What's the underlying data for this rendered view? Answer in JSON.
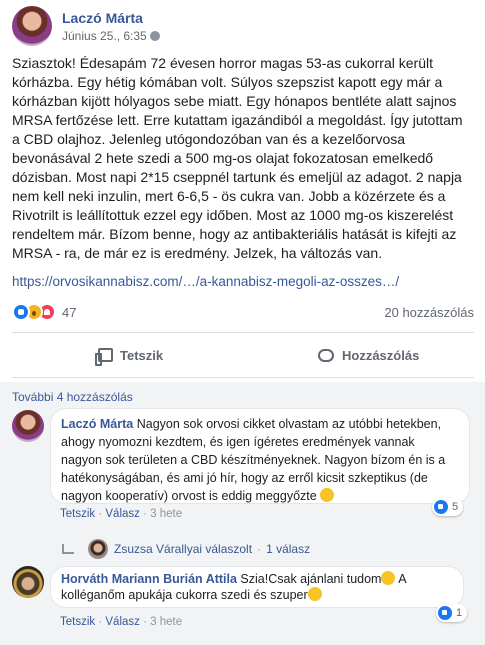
{
  "post": {
    "author": "Laczó Márta",
    "time": "Június 25., 6:35",
    "text": "Sziasztok! Édesapám 72 évesen horror magas 53-as cukorral került kórházba. Egy hétig kómában volt. Súlyos szepszist kapott egy már a kórházban kijött hólyagos sebe miatt. Egy hónapos bentléte alatt sajnos MRSA fertőzése lett. Erre kutattam igazándiból a megoldást. Így jutottam a CBD olajhoz. Jelenleg utógondozóban van és a kezelőorvosa bevonásával 2 hete szedi a 500 mg-os olajat fokozatosan emelkedő dózisban. Most napi 2*15 cseppnél tartunk és emeljül az adagot. 2 napja nem kell neki inzulin, mert 6-6,5 - ös cukra van. Jobb a közérzete és a Rivotrilt is leállítottuk ezzel egy időben. Most az 1000 mg-os kiszerelést rendeltem már. Bízom benne, hogy az antibakteriális hatását is kifejti az MRSA - ra, de már ez is eredmény. Jelzek, ha változás van.",
    "link": "https://orvosikannabisz.com/…/a-kannabisz-megoli-az-osszes…/",
    "reaction_count": "47",
    "comment_count": "20 hozzászólás"
  },
  "actions": {
    "like_label": "Tetszik",
    "comment_label": "Hozzászólás"
  },
  "comments": {
    "more_label": "További 4 hozzászólás",
    "items": [
      {
        "name": "Laczó Márta",
        "text": " Nagyon sok orvosi cikket olvastam az utóbbi hetekben, ahogy nyomozni kezdtem, és igen ígéretes eredmények vannak nagyon sok területen a CBD készítményeknek. Nagyon bízom én is a hatékonyságában, és ami jó hír, hogy az erről kicsit szkeptikus (de nagyon kooperatív) orvost is eddig meggyőzte",
        "like": "Tetszik",
        "reply": "Válasz",
        "age": "3 hete",
        "reactions": "5"
      },
      {
        "name": "Horváth Mariann Burián Attila",
        "text": " Szia!Csak ajánlani tudom",
        "text2": "A kolléganőm apukája cukorra szedi és szuper",
        "like": "Tetszik",
        "reply": "Válasz",
        "age": "3 hete",
        "reactions": "1"
      }
    ],
    "reply_summary": {
      "name": "Zsuzsa Várallyai válaszolt",
      "count": "1 válasz"
    }
  }
}
